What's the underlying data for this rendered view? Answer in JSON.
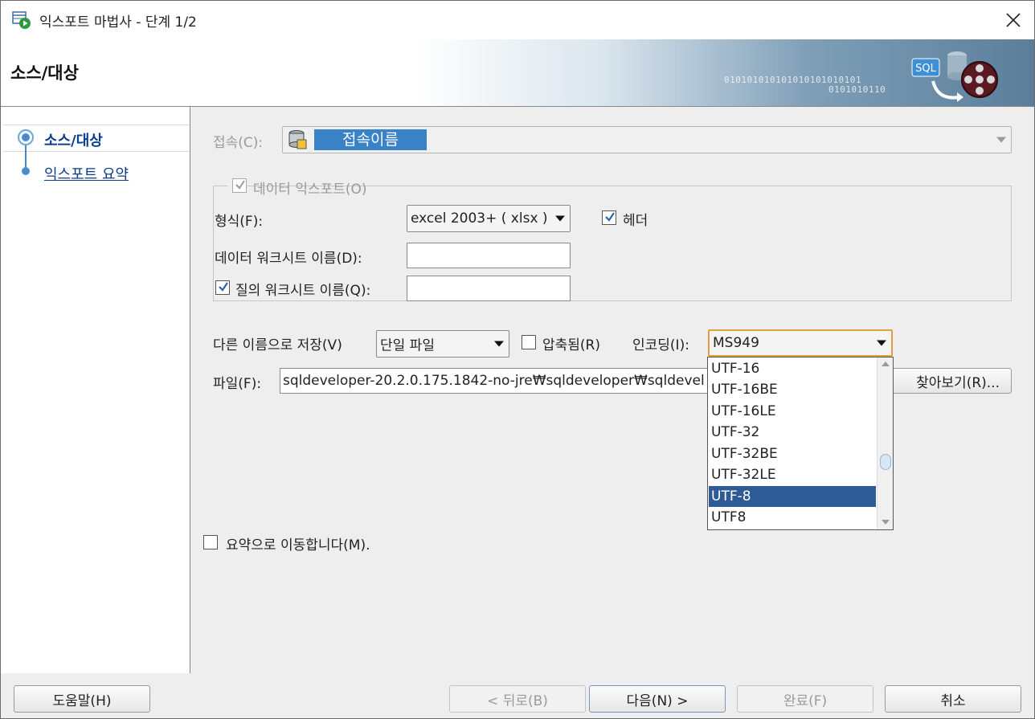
{
  "window": {
    "title": "익스포트 마법사 - 단계 1/2"
  },
  "banner": {
    "title": "소스/대상",
    "bits1": "010101010101010101010101",
    "bits2": "0101010110",
    "art_label": "SQL"
  },
  "steps": [
    {
      "label": "소스/대상",
      "active": true
    },
    {
      "label": "익스포트 요약",
      "active": false
    }
  ],
  "connection": {
    "label": "접속(C):",
    "value": "접속이름"
  },
  "data_export": {
    "label": "데이터 익스포트(O)",
    "checked": true
  },
  "format": {
    "label": "형식(F):",
    "value": "excel 2003+ ( xlsx )"
  },
  "header": {
    "label": "헤더",
    "checked": true
  },
  "data_sheet": {
    "label": "데이터 워크시트 이름(D):",
    "value": ""
  },
  "query_sheet": {
    "label": "질의 워크시트 이름(Q):",
    "value": "",
    "checked": true
  },
  "save_as": {
    "label": "다른 이름으로 저장(V)",
    "value": "단일 파일"
  },
  "compressed": {
    "label": "압축됨(R)",
    "checked": false
  },
  "encoding": {
    "label": "인코딩(I):",
    "value": "MS949",
    "options": [
      "UTF-16",
      "UTF-16BE",
      "UTF-16LE",
      "UTF-32",
      "UTF-32BE",
      "UTF-32LE",
      "UTF-8",
      "UTF8"
    ],
    "highlighted": "UTF-8"
  },
  "file": {
    "label": "파일(F):",
    "value": "sqldeveloper-20.2.0.175.1842-no-jre₩sqldeveloper₩sqldevel",
    "browse_label": "찾아보기(R)..."
  },
  "goto_summary": {
    "label": "요약으로 이동합니다(M).",
    "checked": false
  },
  "buttons": {
    "help": "도움말(H)",
    "back": "< 뒤로(B)",
    "next": "다음(N) >",
    "finish": "완료(F)",
    "cancel": "취소"
  },
  "colors": {
    "selection": "#2e5b95",
    "link": "#0b3d8f",
    "chip": "#3a82c8"
  }
}
